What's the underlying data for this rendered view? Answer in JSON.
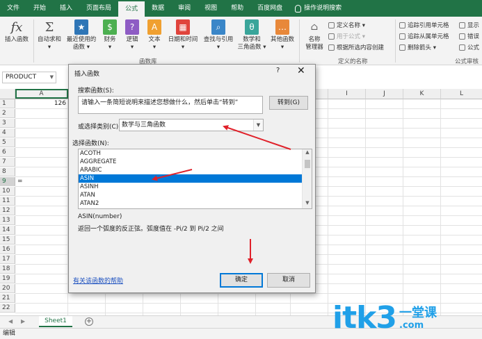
{
  "menu": {
    "tabs": [
      "文件",
      "开始",
      "插入",
      "页面布局",
      "公式",
      "数据",
      "审阅",
      "视图",
      "帮助",
      "百度网盘"
    ],
    "active_tab": "公式",
    "search_label": "操作说明搜索"
  },
  "ribbon": {
    "insert_function": "插入函数",
    "autosum": [
      "自动求和",
      "▾"
    ],
    "recent": [
      "最近使用的",
      "函数 ▾"
    ],
    "finance": [
      "财务",
      "▾"
    ],
    "logic": [
      "逻辑",
      "▾"
    ],
    "text": [
      "文本",
      "▾"
    ],
    "datetime": [
      "日期和时间",
      "▾"
    ],
    "lookup": [
      "查找与引用",
      "▾"
    ],
    "math": [
      "数学和",
      "三角函数 ▾"
    ],
    "other": [
      "其他函数",
      "▾"
    ],
    "library_label": "函数库",
    "name_manager": [
      "名称",
      "管理器"
    ],
    "define_name": "定义名称 ▾",
    "use_in_formula": "用于公式 ▾",
    "create_from_selection": "根据所选内容创建",
    "defined_names_label": "定义的名称",
    "trace_precedents": "追踪引用单元格",
    "trace_dependents": "追踪从属单元格",
    "remove_arrows": "删除箭头 ▾",
    "show_formulas": "显示",
    "error_check": "错误",
    "evaluate": "公式",
    "audit_label": "公式审核"
  },
  "formula_bar": {
    "name_box": "PRODUCT"
  },
  "sheet": {
    "columns": [
      "A",
      "B",
      "C",
      "D",
      "E",
      "F",
      "G",
      "H",
      "I",
      "J",
      "K",
      "L"
    ],
    "rows": [
      "1",
      "2",
      "3",
      "4",
      "5",
      "6",
      "7",
      "8",
      "9",
      "10",
      "11",
      "12",
      "13",
      "14",
      "15",
      "16",
      "17",
      "18",
      "19",
      "20",
      "21",
      "22"
    ],
    "a1_value": "126",
    "a9_value": "=",
    "tab_name": "Sheet1",
    "add_sheet": "+",
    "status": "编辑"
  },
  "dialog": {
    "title": "插入函数",
    "help_glyph": "?",
    "close_glyph": "✕",
    "search_label": "搜索函数(S):",
    "search_value": "请输入一条简短说明来描述您想做什么，然后单击“转到”",
    "go_button": "转到(G)",
    "category_label": "或选择类别(C):",
    "category_value": "数学与三角函数",
    "function_label": "选择函数(N):",
    "functions": [
      "ACOTH",
      "AGGREGATE",
      "ARABIC",
      "ASIN",
      "ASINH",
      "ATAN",
      "ATAN2"
    ],
    "selected_function": "ASIN",
    "signature": "ASIN(number)",
    "description": "返回一个弧度的反正弦。弧度值在 -Pi/2 到 Pi/2 之间",
    "help_link": "有关该函数的帮助",
    "ok_button": "确定",
    "cancel_button": "取消"
  },
  "watermark": {
    "text": "itk3",
    "sub_top": "一堂课",
    "sub_bottom": ".com"
  },
  "colors": {
    "excel_green": "#217346",
    "annotation_red": "#e0212a",
    "selection_blue": "#0078d7",
    "watermark_blue": "#20a0e8"
  }
}
